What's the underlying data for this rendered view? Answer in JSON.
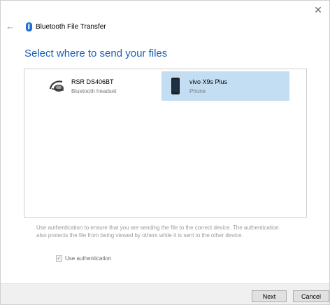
{
  "window": {
    "close_glyph": "✕",
    "back_glyph": "←",
    "title": "Bluetooth File Transfer",
    "bluetooth_glyph": "ᛒ"
  },
  "main": {
    "heading": "Select where to send your files",
    "devices": [
      {
        "name": "RSR DS406BT",
        "type": "Bluetooth headset",
        "icon": "headset-icon",
        "selected": false
      },
      {
        "name": "vivo X9s Plus",
        "type": "Phone",
        "icon": "phone-icon",
        "selected": true
      }
    ],
    "auth_description": "Use authentication to ensure that you are sending the file to the correct device. The authentication also protects the file from being viewed by others while it is sent to the other device.",
    "auth_checkbox_label": "Use authentication",
    "auth_checked": true,
    "check_glyph": "✓"
  },
  "footer": {
    "next_label": "Next",
    "cancel_label": "Cancel"
  },
  "colors": {
    "accent": "#1c5fb6",
    "selection": "#c3ddf3",
    "bluetooth": "#1e6fd6"
  }
}
